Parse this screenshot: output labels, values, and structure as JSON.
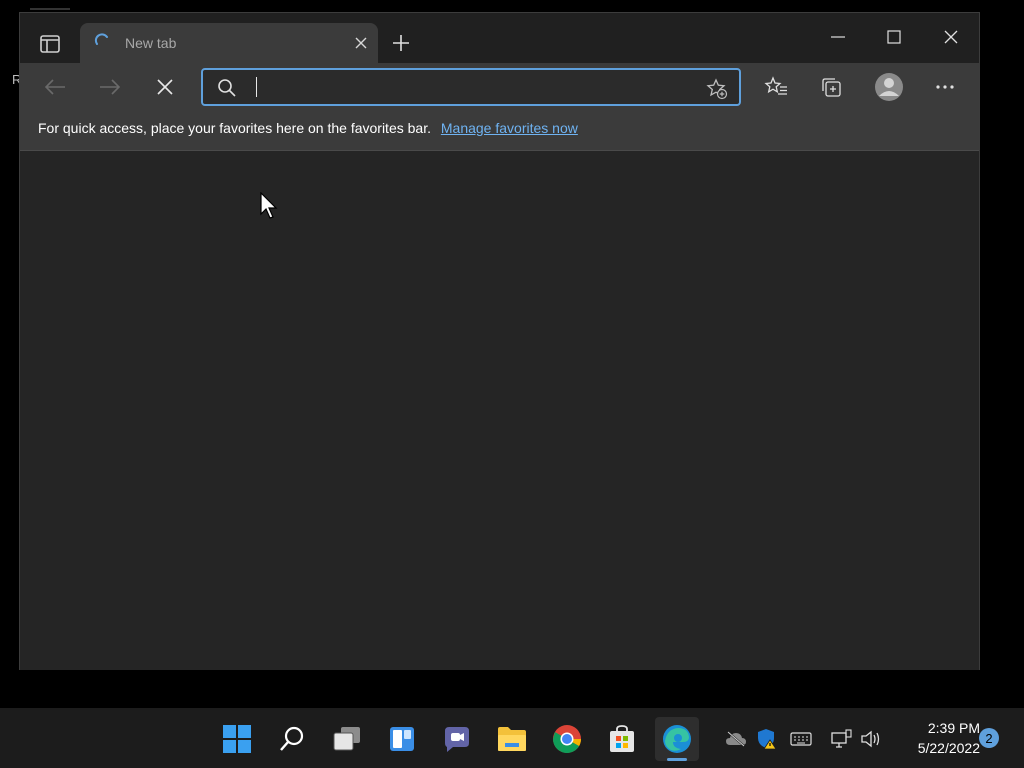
{
  "desktop": {
    "stray_text": "R"
  },
  "browser": {
    "tab": {
      "title": "New tab"
    },
    "address_bar": {
      "value": "",
      "placeholder": ""
    },
    "favorites_bar": {
      "message": "For quick access, place your favorites here on the favorites bar.",
      "link_label": "Manage favorites now"
    },
    "icons": {
      "tab_actions": "tab-actions-icon",
      "back": "back-arrow-icon",
      "forward": "forward-arrow-icon",
      "stop": "stop-loading-icon",
      "search": "search-icon",
      "add_favorite": "star-add-icon",
      "favorites": "favorites-icon",
      "collections": "collections-icon",
      "profile": "profile-avatar-icon",
      "more": "more-ellipsis-icon"
    }
  },
  "taskbar": {
    "apps": [
      {
        "name": "start",
        "icon": "windows-start-icon"
      },
      {
        "name": "search",
        "icon": "search-icon"
      },
      {
        "name": "task-view",
        "icon": "task-view-icon"
      },
      {
        "name": "widgets",
        "icon": "widgets-icon"
      },
      {
        "name": "chat",
        "icon": "teams-chat-icon"
      },
      {
        "name": "file-explorer",
        "icon": "folder-icon"
      },
      {
        "name": "chrome",
        "icon": "chrome-icon"
      },
      {
        "name": "store",
        "icon": "store-icon"
      },
      {
        "name": "edge",
        "icon": "edge-icon",
        "active": true
      }
    ],
    "tray": [
      "onedrive-offline-icon",
      "defender-warning-icon",
      "keyboard-icon",
      "network-icon",
      "volume-icon"
    ],
    "clock": {
      "time": "2:39 PM",
      "date": "5/22/2022"
    },
    "notification_count": "2"
  },
  "colors": {
    "accent": "#5fa0dc",
    "link": "#6fb3f2",
    "window_bg": "#252525",
    "toolbar_bg": "#3b3b3b",
    "taskbar_bg": "#1c1c1c"
  }
}
